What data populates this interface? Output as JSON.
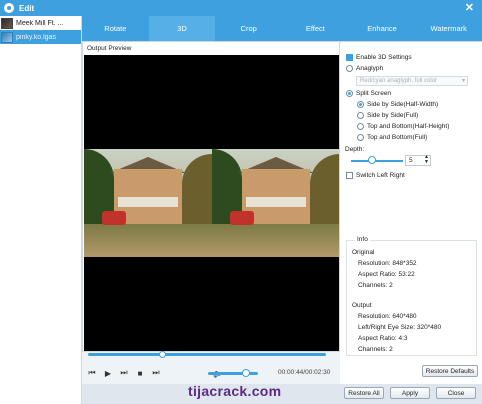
{
  "window": {
    "title": "Edit"
  },
  "files": [
    {
      "name": "Meek Mill Ft. ..."
    },
    {
      "name": "pinky.ko.lgas"
    }
  ],
  "tabs": [
    "Rotate",
    "3D",
    "Crop",
    "Effect",
    "Enhance",
    "Watermark"
  ],
  "active_tab": "3D",
  "preview": {
    "label": "Output Preview"
  },
  "player": {
    "time": "00:00:44/00:02:30",
    "progress": 0.3,
    "volume": 0.75
  },
  "settings3d": {
    "enable_label": "Enable 3D Settings",
    "anaglyph_label": "Anaglyph",
    "anaglyph_select": "Red/cyan anaglyph, full color",
    "split_label": "Split Screen",
    "options": [
      "Side by Side(Half-Width)",
      "Side by Side(Full)",
      "Top and Bottom(Half-Height)",
      "Top and Bottom(Full)"
    ],
    "depth_label": "Depth:",
    "depth_value": "5",
    "switch_label": "Switch Left Right"
  },
  "info": {
    "title": "Info",
    "original_heading": "Original",
    "original": [
      "Resolution: 848*352",
      "Aspect Ratio: 53:22",
      "Channels: 2"
    ],
    "output_heading": "Output",
    "output": [
      "Resolution: 640*480",
      "Left/Right Eye Size: 320*480",
      "Aspect Ratio: 4:3",
      "Channels: 2"
    ]
  },
  "buttons": {
    "restore_defaults": "Restore Defaults",
    "restore_all": "Restore All",
    "apply": "Apply",
    "close": "Close"
  },
  "watermark": "tijacrack.com",
  "colors": {
    "accent": "#3fa0df"
  }
}
